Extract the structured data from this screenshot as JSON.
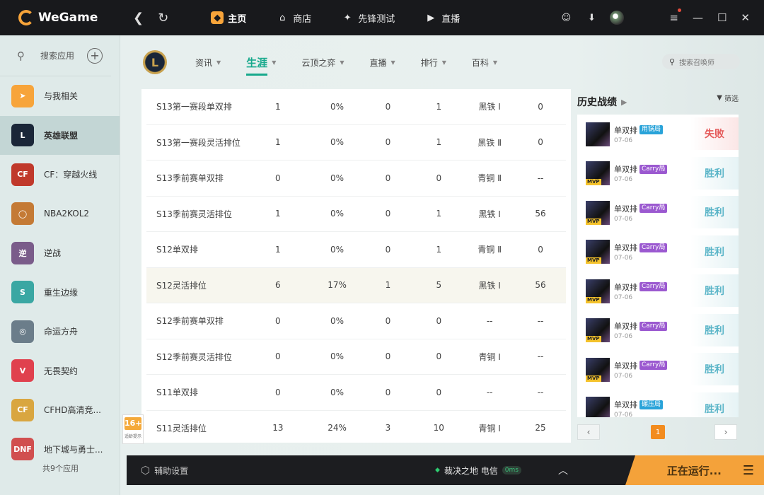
{
  "app": {
    "name": "WeGame"
  },
  "topnav": {
    "back": "❮",
    "refresh": "↻",
    "items": [
      {
        "label": "主页",
        "icon": "home-icon",
        "glyph": "◆",
        "active": true
      },
      {
        "label": "商店",
        "icon": "store-icon",
        "glyph": "⌂",
        "active": false
      },
      {
        "label": "先锋测试",
        "icon": "pioneer-test-icon",
        "glyph": "✦",
        "active": false
      },
      {
        "label": "直播",
        "icon": "live-icon",
        "glyph": "▶",
        "active": false
      }
    ],
    "window_controls": {
      "menu": "≡",
      "minimize": "—",
      "maximize": "☐",
      "close": "✕"
    }
  },
  "sidebar": {
    "search_label": "搜索应用",
    "search_icon": "⚲",
    "add": "+",
    "games": [
      {
        "name": "与我相关",
        "icon_text": "➤",
        "color": "#f7a43a",
        "active": false
      },
      {
        "name": "英雄联盟",
        "icon_text": "L",
        "color": "#1a2638",
        "active": true
      },
      {
        "name": "CF：穿越火线",
        "icon_text": "CF",
        "color": "#c0392b",
        "active": false
      },
      {
        "name": "NBA2KOL2",
        "icon_text": "◯",
        "color": "#c47a35",
        "active": false
      },
      {
        "name": "逆战",
        "icon_text": "逆",
        "color": "#7a5c8a",
        "active": false
      },
      {
        "name": "重生边缘",
        "icon_text": "S",
        "color": "#3aa7a3",
        "active": false
      },
      {
        "name": "命运方舟",
        "icon_text": "◎",
        "color": "#6b7d8a",
        "active": false
      },
      {
        "name": "无畏契约",
        "icon_text": "V",
        "color": "#e0414e",
        "active": false
      },
      {
        "name": "CFHD高清竞...",
        "icon_text": "CF",
        "color": "#d9a640",
        "active": false
      },
      {
        "name": "地下城与勇士...",
        "icon_text": "DNF",
        "color": "#d14f4f",
        "active": false
      }
    ],
    "footer": "共9个应用"
  },
  "game_tabs": {
    "logo": "L",
    "tabs": [
      {
        "label": "资讯",
        "active": false,
        "caret": "▼"
      },
      {
        "label": "生涯",
        "active": true,
        "caret": "▼"
      },
      {
        "label": "云顶之弈",
        "active": false,
        "caret": "▼"
      },
      {
        "label": "直播",
        "active": false,
        "caret": "▼"
      },
      {
        "label": "排行",
        "active": false,
        "caret": "▼"
      },
      {
        "label": "百科",
        "active": false,
        "caret": "▼"
      }
    ],
    "search_placeholder": "搜索召唤师",
    "search_icon": "⚲"
  },
  "career_table": {
    "rows": [
      [
        "S13第一赛段单双排",
        "1",
        "0%",
        "0",
        "1",
        "黑铁 Ⅰ",
        "0"
      ],
      [
        "S13第一赛段灵活排位",
        "1",
        "0%",
        "0",
        "1",
        "黑铁 Ⅱ",
        "0"
      ],
      [
        "S13季前赛单双排",
        "0",
        "0%",
        "0",
        "0",
        "青铜 Ⅱ",
        "--"
      ],
      [
        "S13季前赛灵活排位",
        "1",
        "0%",
        "0",
        "1",
        "黑铁 Ⅰ",
        "56"
      ],
      [
        "S12单双排",
        "1",
        "0%",
        "0",
        "1",
        "青铜 Ⅱ",
        "0"
      ],
      [
        "S12灵活排位",
        "6",
        "17%",
        "1",
        "5",
        "黑铁 Ⅰ",
        "56"
      ],
      [
        "S12季前赛单双排",
        "0",
        "0%",
        "0",
        "0",
        "--",
        "--"
      ],
      [
        "S12季前赛灵活排位",
        "0",
        "0%",
        "0",
        "0",
        "青铜 Ⅰ",
        "--"
      ],
      [
        "S11单双排",
        "0",
        "0%",
        "0",
        "0",
        "--",
        "--"
      ],
      [
        "S11灵活排位",
        "13",
        "24%",
        "3",
        "10",
        "青铜 Ⅰ",
        "25"
      ]
    ],
    "highlight_row": 5
  },
  "history": {
    "title": "历史战绩",
    "arrow": "▶",
    "filter_label": "筛选",
    "filter_icon": "▼",
    "mvp_label": "MVP",
    "matches": [
      {
        "mode": "单双排",
        "tag": "用锅局",
        "tag_color": "#29a3d9",
        "date": "07-06",
        "result": "失败",
        "win": false,
        "mvp": false
      },
      {
        "mode": "单双排",
        "tag": "Carry局",
        "tag_color": "#9b59d0",
        "date": "07-06",
        "result": "胜利",
        "win": true,
        "mvp": true
      },
      {
        "mode": "单双排",
        "tag": "Carry局",
        "tag_color": "#9b59d0",
        "date": "07-06",
        "result": "胜利",
        "win": true,
        "mvp": true
      },
      {
        "mode": "单双排",
        "tag": "Carry局",
        "tag_color": "#9b59d0",
        "date": "07-06",
        "result": "胜利",
        "win": true,
        "mvp": true
      },
      {
        "mode": "单双排",
        "tag": "Carry局",
        "tag_color": "#9b59d0",
        "date": "07-06",
        "result": "胜利",
        "win": true,
        "mvp": true
      },
      {
        "mode": "单双排",
        "tag": "Carry局",
        "tag_color": "#9b59d0",
        "date": "07-06",
        "result": "胜利",
        "win": true,
        "mvp": true
      },
      {
        "mode": "单双排",
        "tag": "Carry局",
        "tag_color": "#9b59d0",
        "date": "07-06",
        "result": "胜利",
        "win": true,
        "mvp": true
      },
      {
        "mode": "单双排",
        "tag": "碾压局",
        "tag_color": "#29a3d9",
        "date": "07-06",
        "result": "胜利",
        "win": true,
        "mvp": false
      }
    ],
    "pager": {
      "prev": "‹",
      "next": "›",
      "page": "1"
    }
  },
  "age_badge": {
    "rating": "16+",
    "text": "适龄提示"
  },
  "bottombar": {
    "assist_label": "辅助设置",
    "assist_icon": "⬡",
    "server_dot": "◆",
    "server": "裁决之地 电信",
    "ping": "0ms",
    "expand": "︿",
    "running_label": "正在运行...",
    "menu_icon": "☰"
  },
  "colors": {
    "accent": "#17a98c",
    "brand": "#f7a43a",
    "win": "#5bb5c8",
    "lose": "#e55b5b"
  }
}
